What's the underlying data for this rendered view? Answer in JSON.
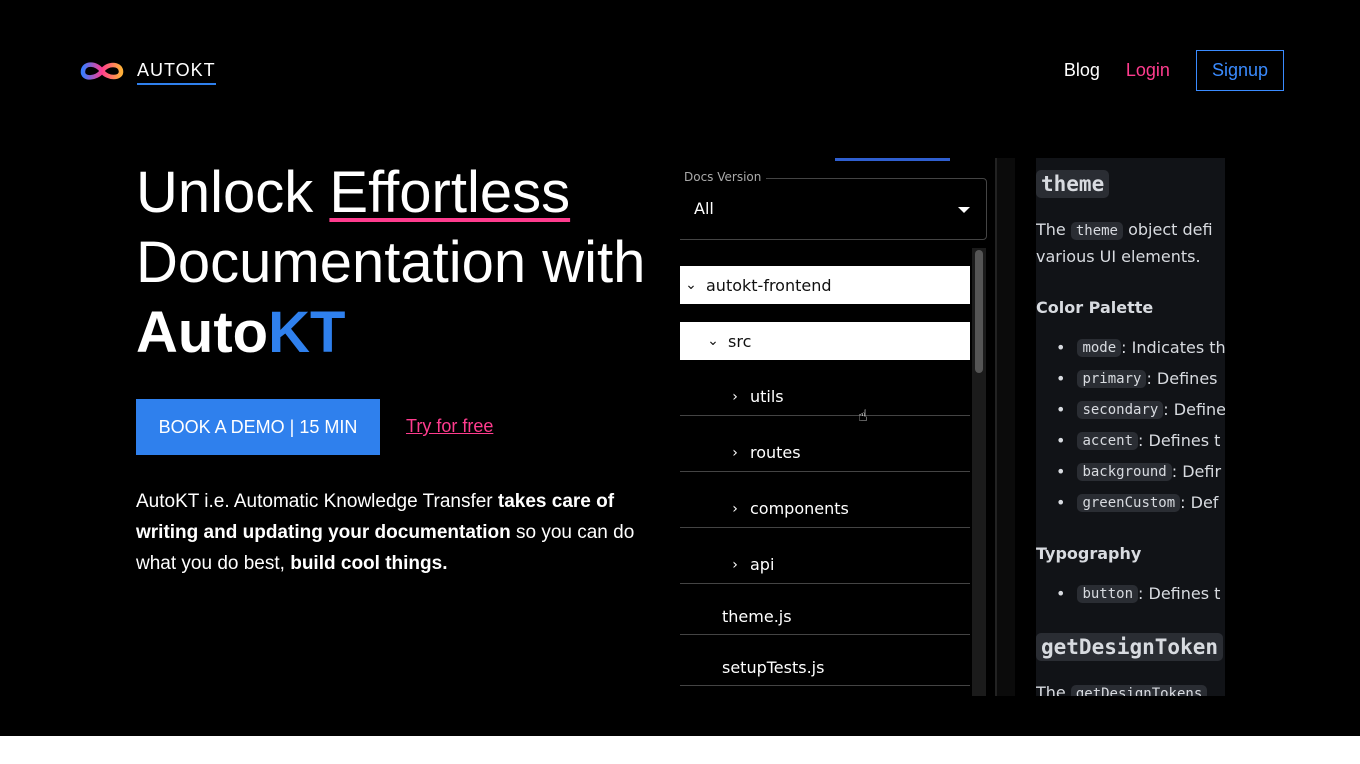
{
  "header": {
    "logo_text": "AUTOKT",
    "nav": {
      "blog": "Blog",
      "login": "Login",
      "signup": "Signup"
    }
  },
  "hero": {
    "title": {
      "line1_a": "Unlock ",
      "line1_b": "Effortless",
      "line2": "Documentation with",
      "line3_a": "Auto",
      "line3_b": "KT"
    },
    "cta_primary": "BOOK A DEMO | 15 MIN",
    "cta_secondary": "Try for free",
    "desc": {
      "a": "AutoKT i.e. Automatic Knowledge Transfer ",
      "b": "takes care of writing and updating your documentation",
      "c": " so you can do what you do best, ",
      "d": "build cool things."
    }
  },
  "colors": {
    "accent_blue": "#2f80ed",
    "accent_pink": "#ff3c8e",
    "background": "#000000"
  },
  "demo": {
    "docs_version": {
      "label": "Docs Version",
      "value": "All"
    },
    "tree": [
      {
        "label": "autokt-frontend",
        "icon": "chevron-down-icon",
        "selected": true
      },
      {
        "label": "src",
        "icon": "chevron-down-icon",
        "selected": true
      },
      {
        "label": "utils",
        "icon": "chevron-right-icon"
      },
      {
        "label": "routes",
        "icon": "chevron-right-icon"
      },
      {
        "label": "components",
        "icon": "chevron-right-icon"
      },
      {
        "label": "api",
        "icon": "chevron-right-icon"
      },
      {
        "label": "theme.js"
      },
      {
        "label": "setupTests.js"
      }
    ],
    "doc": {
      "heading": "theme",
      "intro_a": "The ",
      "intro_code": "theme",
      "intro_b": " object defi",
      "intro_line2": "various UI elements.",
      "color_palette": "Color Palette",
      "palette": [
        {
          "code": "mode",
          "text": ": Indicates th"
        },
        {
          "code": "primary",
          "text": ": Defines"
        },
        {
          "code": "secondary",
          "text": ": Define"
        },
        {
          "code": "accent",
          "text": ": Defines t"
        },
        {
          "code": "background",
          "text": ": Defir"
        },
        {
          "code": "greenCustom",
          "text": ": Def"
        }
      ],
      "typography": "Typography",
      "typo": [
        {
          "code": "button",
          "text": ": Defines t"
        }
      ],
      "heading2": "getDesignToken",
      "intro2_a": "The ",
      "intro2_code": "getDesignTokens"
    }
  }
}
